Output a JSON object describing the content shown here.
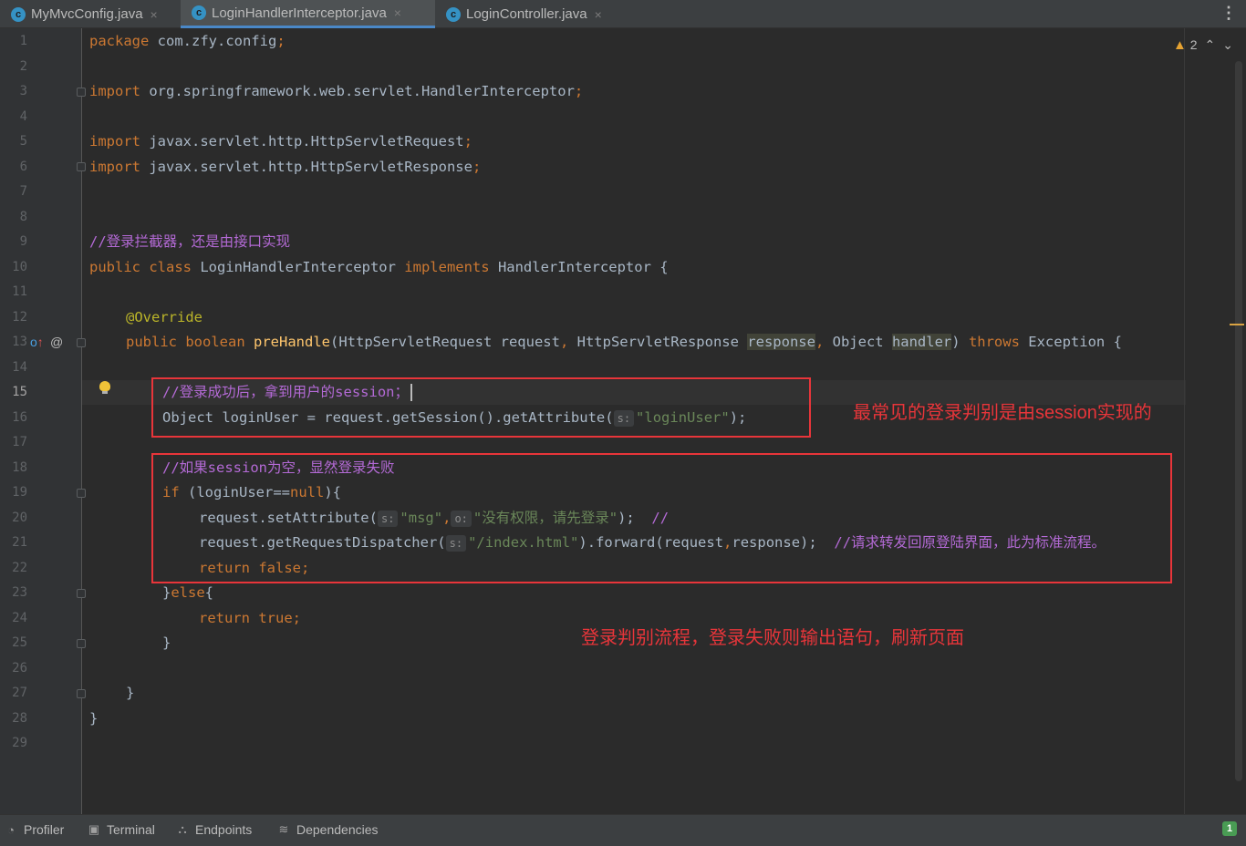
{
  "tabs": [
    {
      "label": "MyMvcConfig.java",
      "active": false
    },
    {
      "label": "LoginHandlerInterceptor.java",
      "active": true
    },
    {
      "label": "LoginController.java",
      "active": false
    }
  ],
  "tab_icon_letter": "c",
  "close_glyph": "×",
  "menu_glyph": "⋮",
  "inspection": {
    "warning_icon": "warning-triangle-icon",
    "warning_count": "2",
    "up_glyph": "⌃",
    "down_glyph": "⌄"
  },
  "current_line": 15,
  "line_numbers": [
    "1",
    "2",
    "3",
    "4",
    "5",
    "6",
    "7",
    "8",
    "9",
    "10",
    "11",
    "12",
    "13",
    "14",
    "15",
    "16",
    "17",
    "18",
    "19",
    "20",
    "21",
    "22",
    "23",
    "24",
    "25",
    "26",
    "27",
    "28",
    "29"
  ],
  "code": {
    "l1": {
      "kw": "package",
      "rest": " com.zfy.config",
      "semi": ";"
    },
    "l3": {
      "kw": "import",
      "rest": " org.springframework.web.servlet.HandlerInterceptor",
      "semi": ";"
    },
    "l5": {
      "kw": "import",
      "rest": " javax.servlet.http.HttpServletRequest",
      "semi": ";"
    },
    "l6": {
      "kw": "import",
      "rest": " javax.servlet.http.HttpServletResponse",
      "semi": ";"
    },
    "l9": {
      "comment": "//登录拦截器，还是由接口实现"
    },
    "l10": {
      "kw1": "public class",
      "name": " LoginHandlerInterceptor ",
      "kw2": "implements",
      "rest": " HandlerInterceptor {"
    },
    "l12": {
      "annotation": "@Override"
    },
    "l13": {
      "kw1": "public boolean",
      "fn": "preHandle",
      "p1": "(HttpServletRequest request",
      "c1": ",",
      "p2": " HttpServletResponse ",
      "hl1": "response",
      "c2": ",",
      "p3": " Object ",
      "hl2": "handler",
      "p4": ") ",
      "kw2": "throws",
      "p5": " Exception {"
    },
    "l15": {
      "comment": "//登录成功后，拿到用户的session；"
    },
    "l16": {
      "p1": "Object loginUser = request.getSession().getAttribute(",
      "hint": "s:",
      "str": "\"loginUser\"",
      "p2": ");"
    },
    "l18": {
      "comment": "//如果session为空，显然登录失败"
    },
    "l19": {
      "kw": "if",
      "p1": " (loginUser==",
      "kw2": "null",
      "p2": "){"
    },
    "l20": {
      "p1": "request.setAttribute(",
      "hint1": "s:",
      "str1": "\"msg\"",
      "c": ",",
      "hint2": "o:",
      "str2": "\"没有权限，请先登录\"",
      "p2": ");  ",
      "comment": "//"
    },
    "l21": {
      "p1": "request.getRequestDispatcher(",
      "hint": "s:",
      "str": "\"/index.html\"",
      "p2": ").forward(request",
      "c": ",",
      "p3": "response);  ",
      "comment": "//请求转发回原登陆界面，此为标准流程。"
    },
    "l22": {
      "kw": "return false",
      "semi": ";"
    },
    "l23": {
      "p1": "}",
      "kw": "else",
      "p2": "{"
    },
    "l24": {
      "kw": "return true",
      "semi": ";"
    },
    "l25": {
      "p": "}"
    },
    "l27": {
      "p": "}"
    },
    "l28": {
      "p": "}"
    }
  },
  "annotations": {
    "session_note": "最常见的登录判别是由session实现的",
    "flow_note": "登录判别流程，登录失败则输出语句，刷新页面"
  },
  "gutter_icons": {
    "override": "override-marker-icon",
    "at": "@"
  },
  "bottom_tools": [
    {
      "label": "Profiler",
      "icon": "profiler-icon"
    },
    {
      "label": "Terminal",
      "icon": "terminal-icon"
    },
    {
      "label": "Endpoints",
      "icon": "endpoints-icon"
    },
    {
      "label": "Dependencies",
      "icon": "dependencies-icon"
    }
  ],
  "status_badge": "1",
  "colors": {
    "keyword": "#cc7832",
    "comment": "#9876aa",
    "string": "#6a8759",
    "function": "#ffc66d",
    "annotation": "#bbb529",
    "red_note": "#e8353a",
    "accent": "#4a88c7"
  }
}
